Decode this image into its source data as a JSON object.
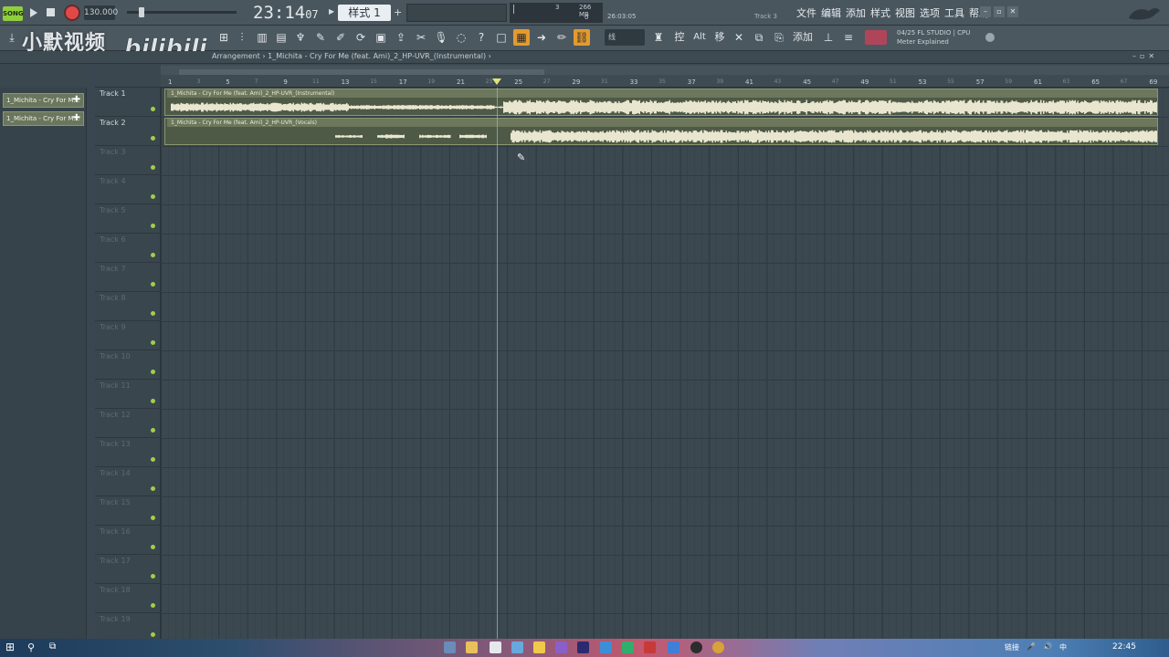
{
  "topbar": {
    "mode_label": "SONG",
    "tempo": "130.000",
    "clock_main": "23:14",
    "clock_sub": "07",
    "pattern": "样式 1",
    "pattern_add": "+",
    "cpu_value": "3",
    "memory": "266 MB",
    "polyphony": "0",
    "hint_time": "26:03:05",
    "hint_track": "Track 3",
    "menu": [
      "文件",
      "编辑",
      "添加",
      "样式",
      "视图",
      "选项",
      "工具",
      "帮助"
    ],
    "window_controls": [
      "–",
      "▫",
      "✕"
    ]
  },
  "toolbar": {
    "snap": "线",
    "add_label": "添加",
    "alt_label": "Alt",
    "move_label": "移",
    "control_label": "控",
    "plugin_line1": "04/25 FL STUDIO | CPU",
    "plugin_line2": "Meter Explained",
    "accent": "#e59a2e"
  },
  "watermark": {
    "text": "小默视频",
    "logo": "bilibili"
  },
  "breadcrumb": {
    "prefix": "Arrangement",
    "separator": "›",
    "current": "1_Michita - Cry For Me (feat. Ami)_2_HP-UVR_(Instrumental)",
    "trail": "›",
    "window_controls": [
      "–",
      "▫",
      "✕"
    ]
  },
  "picker": {
    "items": [
      {
        "label": "1_Michita - Cry For M..."
      },
      {
        "label": "1_Michita - Cry For M..."
      }
    ]
  },
  "ruler": {
    "major": [
      "1",
      "5",
      "9",
      "13",
      "17",
      "21",
      "25",
      "29",
      "33",
      "37",
      "41",
      "45",
      "49",
      "53",
      "57",
      "61",
      "65",
      "69"
    ],
    "minor": [
      "3",
      "7",
      "11",
      "15",
      "19",
      "23",
      "27",
      "31",
      "35",
      "39",
      "43",
      "47",
      "51",
      "55",
      "59",
      "63",
      "67"
    ]
  },
  "tracks": [
    {
      "name": "Track 1"
    },
    {
      "name": "Track 2"
    },
    {
      "name": "Track 3"
    },
    {
      "name": "Track 4"
    },
    {
      "name": "Track 5"
    },
    {
      "name": "Track 6"
    },
    {
      "name": "Track 7"
    },
    {
      "name": "Track 8"
    },
    {
      "name": "Track 9"
    },
    {
      "name": "Track 10"
    },
    {
      "name": "Track 11"
    },
    {
      "name": "Track 12"
    },
    {
      "name": "Track 13"
    },
    {
      "name": "Track 14"
    },
    {
      "name": "Track 15"
    },
    {
      "name": "Track 16"
    },
    {
      "name": "Track 17"
    },
    {
      "name": "Track 18"
    },
    {
      "name": "Track 19"
    }
  ],
  "clips": [
    {
      "title": "1_Michita - Cry For Me (feat. Ami)_2_HP-UVR_(Instrumental)",
      "color": "#e9e6cf"
    },
    {
      "title": "1_Michita - Cry For Me (feat. Ami)_2_HP-UVR_(Vocals)",
      "color": "#e9e6cf"
    }
  ],
  "taskbar": {
    "tray_text": "链接",
    "tray_lang": "中",
    "time": "22:45"
  }
}
